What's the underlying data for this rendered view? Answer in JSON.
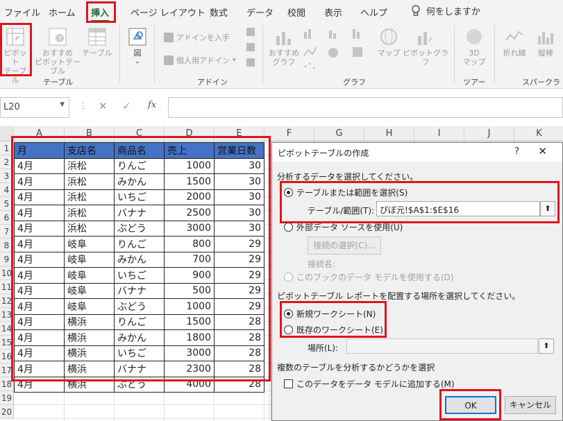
{
  "ribbon": {
    "tabs": [
      "ファイル",
      "ホーム",
      "挿入",
      "ページ レイアウト",
      "数式",
      "データ",
      "校閲",
      "表示",
      "ヘルプ"
    ],
    "active_tab": "挿入",
    "tell_me": "何をしますか",
    "tables_group": {
      "pivot_line1": "ピボット",
      "pivot_line2": "テーブル",
      "recommended_line1": "おすすめ",
      "recommended_line2": "ピボットテーブル",
      "table": "テーブル",
      "label": "テーブル"
    },
    "illustrations": {
      "label": "図"
    },
    "addins": {
      "get_addins": "アドインを入手",
      "my_addins": "個人用アドイン",
      "label": "アドイン"
    },
    "charts": {
      "recommended_line1": "おすすめ",
      "recommended_line2": "グラフ",
      "map": "マップ",
      "pivot_chart": "ピボットグラフ",
      "label": "グラフ"
    },
    "tours": {
      "map3d_line1": "3D",
      "map3d_line2": "マップ",
      "label": "ツアー"
    },
    "sparklines": {
      "line": "折れ線",
      "column": "縦棒",
      "label": "スパークライン"
    }
  },
  "formula_bar": {
    "name_box": "L20",
    "fx": "fx"
  },
  "grid": {
    "columns": [
      "A",
      "B",
      "C",
      "D",
      "E",
      "F",
      "G",
      "H",
      "I",
      "J",
      "K"
    ],
    "rows": [
      "1",
      "2",
      "3",
      "4",
      "5",
      "6",
      "7",
      "8",
      "9",
      "10",
      "11",
      "12",
      "13",
      "14",
      "15",
      "16",
      "17",
      "18",
      "19",
      "20"
    ]
  },
  "table": {
    "headers": [
      "月",
      "支店名",
      "商品名",
      "売上",
      "営業日数"
    ],
    "rows": [
      [
        "4月",
        "浜松",
        "りんご",
        "1000",
        "30"
      ],
      [
        "4月",
        "浜松",
        "みかん",
        "1500",
        "30"
      ],
      [
        "4月",
        "浜松",
        "いちご",
        "2000",
        "30"
      ],
      [
        "4月",
        "浜松",
        "バナナ",
        "2500",
        "30"
      ],
      [
        "4月",
        "浜松",
        "ぶどう",
        "3000",
        "30"
      ],
      [
        "4月",
        "岐阜",
        "りんご",
        "800",
        "29"
      ],
      [
        "4月",
        "岐阜",
        "みかん",
        "700",
        "29"
      ],
      [
        "4月",
        "岐阜",
        "いちご",
        "900",
        "29"
      ],
      [
        "4月",
        "岐阜",
        "バナナ",
        "500",
        "29"
      ],
      [
        "4月",
        "岐阜",
        "ぶどう",
        "1000",
        "29"
      ],
      [
        "4月",
        "横浜",
        "りんご",
        "1500",
        "28"
      ],
      [
        "4月",
        "横浜",
        "みかん",
        "1800",
        "28"
      ],
      [
        "4月",
        "横浜",
        "いちご",
        "3000",
        "28"
      ],
      [
        "4月",
        "横浜",
        "バナナ",
        "2300",
        "28"
      ],
      [
        "4月",
        "横浜",
        "ぶどう",
        "4000",
        "28"
      ]
    ]
  },
  "dialog": {
    "title": "ピボットテーブルの作成",
    "help": "?",
    "close": "✕",
    "section_data": "分析するデータを選択してください。",
    "opt_table_range": "テーブルまたは範囲を選択(S)",
    "table_range_label": "テーブル/範囲(T):",
    "table_range_value": "ぴぼ元!$A$1:$E$16",
    "opt_external": "外部データ ソースを使用(U)",
    "choose_connection": "接続の選択(C)...",
    "connection_name_label": "接続名:",
    "opt_data_model": "このブックのデータ モデルを使用する(D)",
    "section_location": "ピボットテーブル レポートを配置する場所を選択してください。",
    "opt_new_sheet": "新規ワークシート(N)",
    "opt_existing_sheet": "既存のワークシート(E)",
    "location_label": "場所(L):",
    "location_value": "",
    "section_multiple": "複数のテーブルを分析するかどうかを選択",
    "add_to_model": "このデータをデータ モデルに追加する(M)",
    "ok": "OK",
    "cancel": "キャンセル"
  },
  "colors": {
    "accent_green": "#1e6b3a",
    "highlight_red": "#e0141e",
    "table_header_blue": "#4472c4",
    "ok_border": "#0078d7"
  }
}
